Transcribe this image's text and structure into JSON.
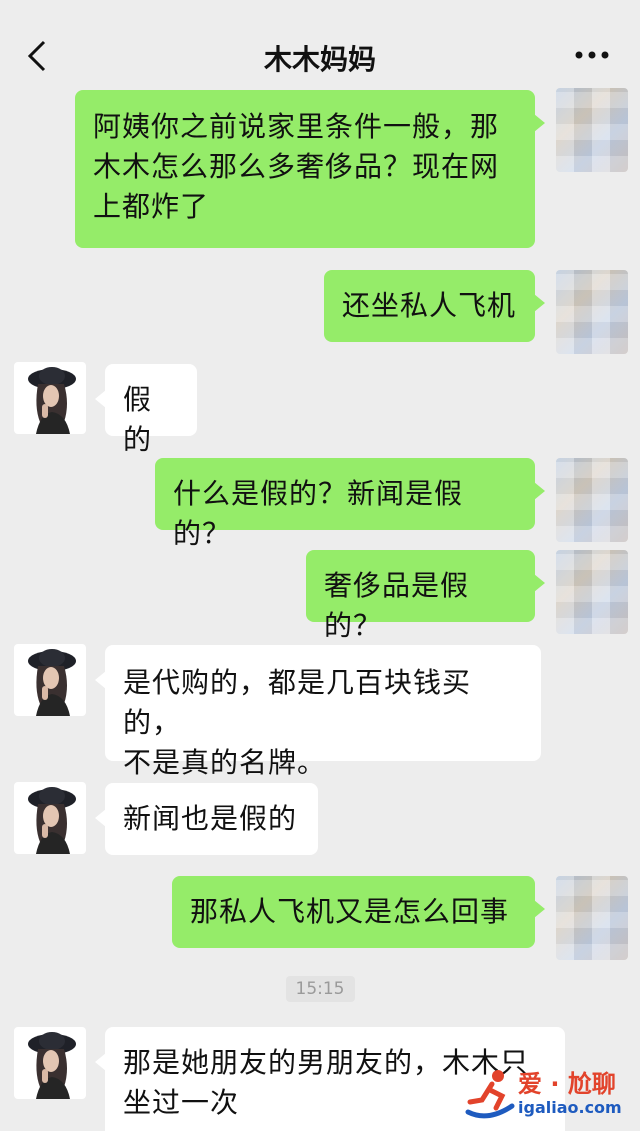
{
  "header": {
    "title": "木木妈妈",
    "back_icon": "chevron-left-icon",
    "more_icon": "more-dots-icon"
  },
  "messages": [
    {
      "side": "right",
      "lines": [
        "阿姨你之前说家里条件一般，那",
        "木木怎么那么多奢侈品？现在网",
        "上都炸了"
      ]
    },
    {
      "side": "right",
      "lines": [
        "还坐私人飞机"
      ]
    },
    {
      "side": "left",
      "lines": [
        "假的"
      ]
    },
    {
      "side": "right",
      "lines": [
        "什么是假的？新闻是假的？"
      ]
    },
    {
      "side": "right",
      "lines": [
        "奢侈品是假的？"
      ]
    },
    {
      "side": "left",
      "lines": [
        "是代购的，都是几百块钱买的，",
        "不是真的名牌。"
      ]
    },
    {
      "side": "left",
      "lines": [
        "新闻也是假的"
      ]
    },
    {
      "side": "right",
      "lines": [
        "那私人飞机又是怎么回事"
      ]
    },
    {
      "side": "left",
      "lines": [
        "那是她朋友的男朋友的，木木只",
        "坐过一次"
      ]
    }
  ],
  "timestamp": "15:15",
  "watermark": {
    "text": "爱 · 尬聊",
    "url": "igaliao.com"
  },
  "colors": {
    "background": "#ededed",
    "bubble_sent": "#95ec69",
    "bubble_received": "#ffffff"
  }
}
